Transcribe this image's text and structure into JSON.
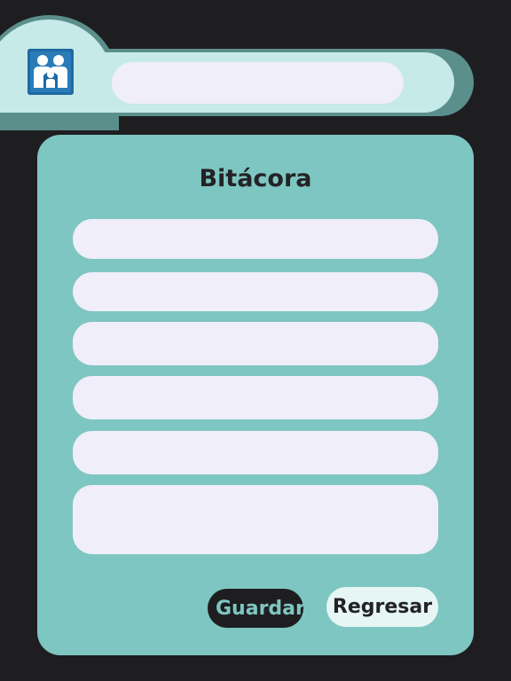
{
  "colors": {
    "background": "#1e1e21",
    "header": "#c5eae8",
    "card": "#7ec6c1",
    "field": "#efeef9",
    "logo": "#1f6aa3"
  },
  "header": {
    "logo_icon": "family-icon",
    "search_value": ""
  },
  "form": {
    "title": "Bitácora",
    "fields": [
      "",
      "",
      "",
      "",
      ""
    ],
    "notes": ""
  },
  "actions": {
    "save_label": "Guardar",
    "back_label": "Regresar"
  }
}
